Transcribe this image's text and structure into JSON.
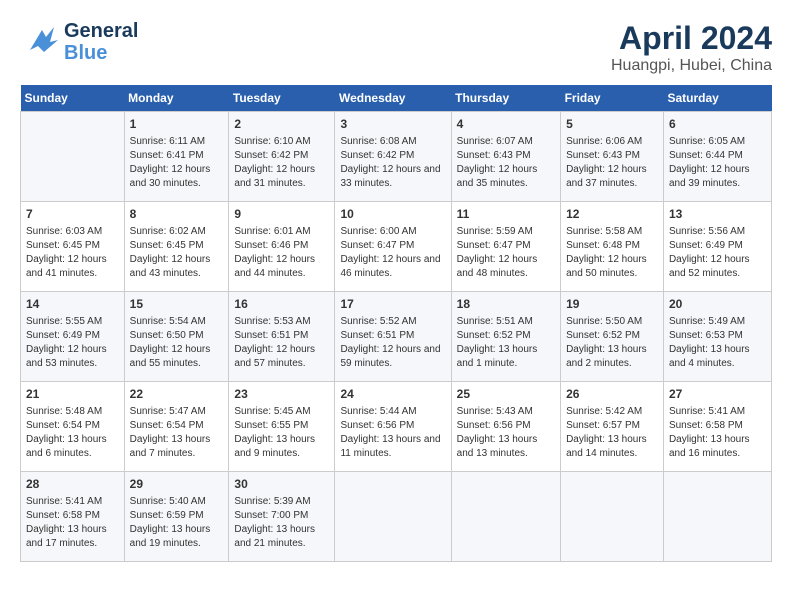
{
  "header": {
    "logo_line1": "General",
    "logo_line2": "Blue",
    "title": "April 2024",
    "subtitle": "Huangpi, Hubei, China"
  },
  "weekdays": [
    "Sunday",
    "Monday",
    "Tuesday",
    "Wednesday",
    "Thursday",
    "Friday",
    "Saturday"
  ],
  "weeks": [
    [
      {
        "day": "",
        "sunrise": "",
        "sunset": "",
        "daylight": ""
      },
      {
        "day": "1",
        "sunrise": "Sunrise: 6:11 AM",
        "sunset": "Sunset: 6:41 PM",
        "daylight": "Daylight: 12 hours and 30 minutes."
      },
      {
        "day": "2",
        "sunrise": "Sunrise: 6:10 AM",
        "sunset": "Sunset: 6:42 PM",
        "daylight": "Daylight: 12 hours and 31 minutes."
      },
      {
        "day": "3",
        "sunrise": "Sunrise: 6:08 AM",
        "sunset": "Sunset: 6:42 PM",
        "daylight": "Daylight: 12 hours and 33 minutes."
      },
      {
        "day": "4",
        "sunrise": "Sunrise: 6:07 AM",
        "sunset": "Sunset: 6:43 PM",
        "daylight": "Daylight: 12 hours and 35 minutes."
      },
      {
        "day": "5",
        "sunrise": "Sunrise: 6:06 AM",
        "sunset": "Sunset: 6:43 PM",
        "daylight": "Daylight: 12 hours and 37 minutes."
      },
      {
        "day": "6",
        "sunrise": "Sunrise: 6:05 AM",
        "sunset": "Sunset: 6:44 PM",
        "daylight": "Daylight: 12 hours and 39 minutes."
      }
    ],
    [
      {
        "day": "7",
        "sunrise": "Sunrise: 6:03 AM",
        "sunset": "Sunset: 6:45 PM",
        "daylight": "Daylight: 12 hours and 41 minutes."
      },
      {
        "day": "8",
        "sunrise": "Sunrise: 6:02 AM",
        "sunset": "Sunset: 6:45 PM",
        "daylight": "Daylight: 12 hours and 43 minutes."
      },
      {
        "day": "9",
        "sunrise": "Sunrise: 6:01 AM",
        "sunset": "Sunset: 6:46 PM",
        "daylight": "Daylight: 12 hours and 44 minutes."
      },
      {
        "day": "10",
        "sunrise": "Sunrise: 6:00 AM",
        "sunset": "Sunset: 6:47 PM",
        "daylight": "Daylight: 12 hours and 46 minutes."
      },
      {
        "day": "11",
        "sunrise": "Sunrise: 5:59 AM",
        "sunset": "Sunset: 6:47 PM",
        "daylight": "Daylight: 12 hours and 48 minutes."
      },
      {
        "day": "12",
        "sunrise": "Sunrise: 5:58 AM",
        "sunset": "Sunset: 6:48 PM",
        "daylight": "Daylight: 12 hours and 50 minutes."
      },
      {
        "day": "13",
        "sunrise": "Sunrise: 5:56 AM",
        "sunset": "Sunset: 6:49 PM",
        "daylight": "Daylight: 12 hours and 52 minutes."
      }
    ],
    [
      {
        "day": "14",
        "sunrise": "Sunrise: 5:55 AM",
        "sunset": "Sunset: 6:49 PM",
        "daylight": "Daylight: 12 hours and 53 minutes."
      },
      {
        "day": "15",
        "sunrise": "Sunrise: 5:54 AM",
        "sunset": "Sunset: 6:50 PM",
        "daylight": "Daylight: 12 hours and 55 minutes."
      },
      {
        "day": "16",
        "sunrise": "Sunrise: 5:53 AM",
        "sunset": "Sunset: 6:51 PM",
        "daylight": "Daylight: 12 hours and 57 minutes."
      },
      {
        "day": "17",
        "sunrise": "Sunrise: 5:52 AM",
        "sunset": "Sunset: 6:51 PM",
        "daylight": "Daylight: 12 hours and 59 minutes."
      },
      {
        "day": "18",
        "sunrise": "Sunrise: 5:51 AM",
        "sunset": "Sunset: 6:52 PM",
        "daylight": "Daylight: 13 hours and 1 minute."
      },
      {
        "day": "19",
        "sunrise": "Sunrise: 5:50 AM",
        "sunset": "Sunset: 6:52 PM",
        "daylight": "Daylight: 13 hours and 2 minutes."
      },
      {
        "day": "20",
        "sunrise": "Sunrise: 5:49 AM",
        "sunset": "Sunset: 6:53 PM",
        "daylight": "Daylight: 13 hours and 4 minutes."
      }
    ],
    [
      {
        "day": "21",
        "sunrise": "Sunrise: 5:48 AM",
        "sunset": "Sunset: 6:54 PM",
        "daylight": "Daylight: 13 hours and 6 minutes."
      },
      {
        "day": "22",
        "sunrise": "Sunrise: 5:47 AM",
        "sunset": "Sunset: 6:54 PM",
        "daylight": "Daylight: 13 hours and 7 minutes."
      },
      {
        "day": "23",
        "sunrise": "Sunrise: 5:45 AM",
        "sunset": "Sunset: 6:55 PM",
        "daylight": "Daylight: 13 hours and 9 minutes."
      },
      {
        "day": "24",
        "sunrise": "Sunrise: 5:44 AM",
        "sunset": "Sunset: 6:56 PM",
        "daylight": "Daylight: 13 hours and 11 minutes."
      },
      {
        "day": "25",
        "sunrise": "Sunrise: 5:43 AM",
        "sunset": "Sunset: 6:56 PM",
        "daylight": "Daylight: 13 hours and 13 minutes."
      },
      {
        "day": "26",
        "sunrise": "Sunrise: 5:42 AM",
        "sunset": "Sunset: 6:57 PM",
        "daylight": "Daylight: 13 hours and 14 minutes."
      },
      {
        "day": "27",
        "sunrise": "Sunrise: 5:41 AM",
        "sunset": "Sunset: 6:58 PM",
        "daylight": "Daylight: 13 hours and 16 minutes."
      }
    ],
    [
      {
        "day": "28",
        "sunrise": "Sunrise: 5:41 AM",
        "sunset": "Sunset: 6:58 PM",
        "daylight": "Daylight: 13 hours and 17 minutes."
      },
      {
        "day": "29",
        "sunrise": "Sunrise: 5:40 AM",
        "sunset": "Sunset: 6:59 PM",
        "daylight": "Daylight: 13 hours and 19 minutes."
      },
      {
        "day": "30",
        "sunrise": "Sunrise: 5:39 AM",
        "sunset": "Sunset: 7:00 PM",
        "daylight": "Daylight: 13 hours and 21 minutes."
      },
      {
        "day": "",
        "sunrise": "",
        "sunset": "",
        "daylight": ""
      },
      {
        "day": "",
        "sunrise": "",
        "sunset": "",
        "daylight": ""
      },
      {
        "day": "",
        "sunrise": "",
        "sunset": "",
        "daylight": ""
      },
      {
        "day": "",
        "sunrise": "",
        "sunset": "",
        "daylight": ""
      }
    ]
  ]
}
